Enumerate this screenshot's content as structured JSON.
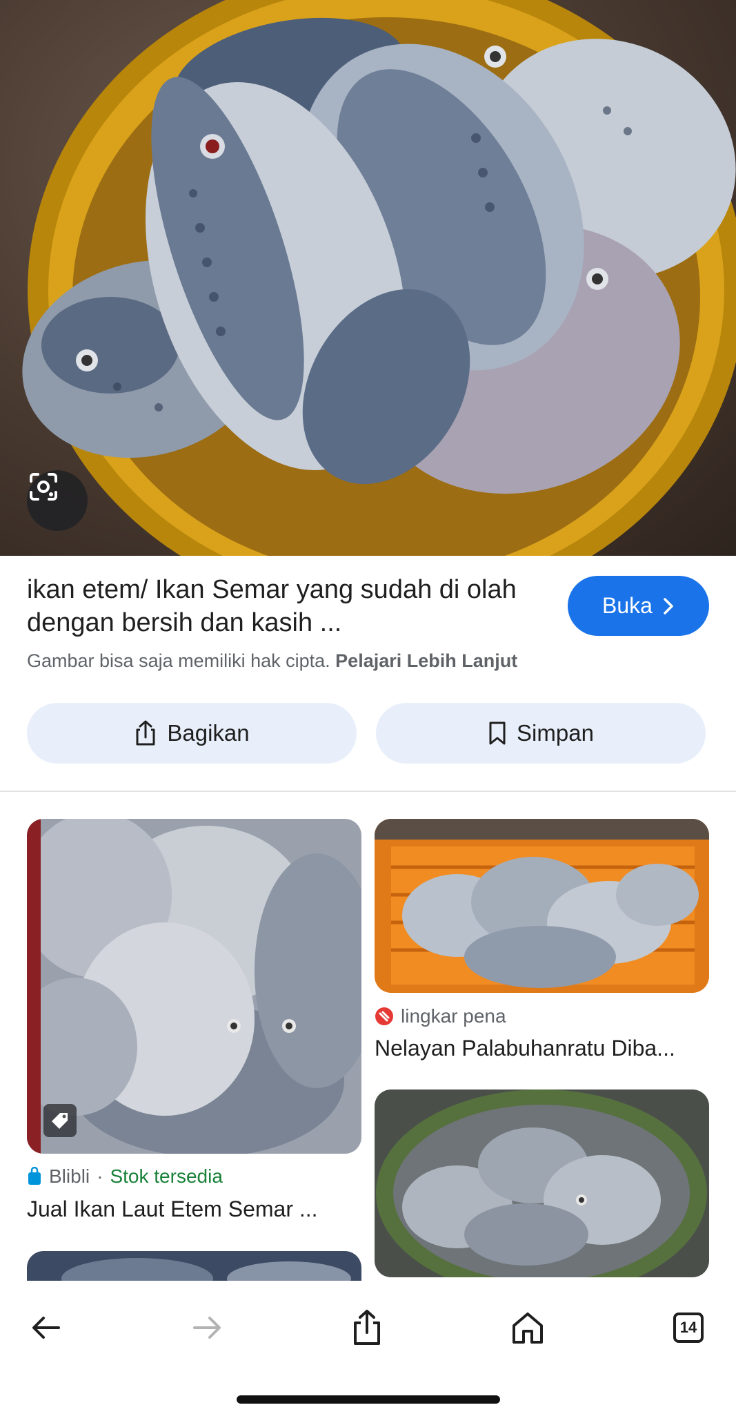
{
  "hero": {
    "image_alt": "ikan etem/ Ikan Semar yang sudah di olah dengan bersih dan kasih ...",
    "lens_icon": "lens-icon"
  },
  "detail": {
    "title": "ikan etem/ Ikan Semar yang sudah di olah dengan bersih dan kasih ...",
    "open_label": "Buka",
    "copyright_text": "Gambar bisa saja memiliki hak cipta. ",
    "learn_more": "Pelajari Lebih Lanjut",
    "share_label": "Bagikan",
    "save_label": "Simpan"
  },
  "results": [
    {
      "source": "Blibli",
      "stock": "Stok tersedia",
      "title": "Jual Ikan Laut Etem Semar ..."
    },
    {
      "source": "lingkar pena",
      "title": "Nelayan Palabuhanratu Diba..."
    }
  ],
  "toolbar": {
    "tabs_count": "14"
  },
  "colors": {
    "accent": "#1a73e8",
    "chip_bg": "#e8effa",
    "stock_green": "#188038"
  }
}
